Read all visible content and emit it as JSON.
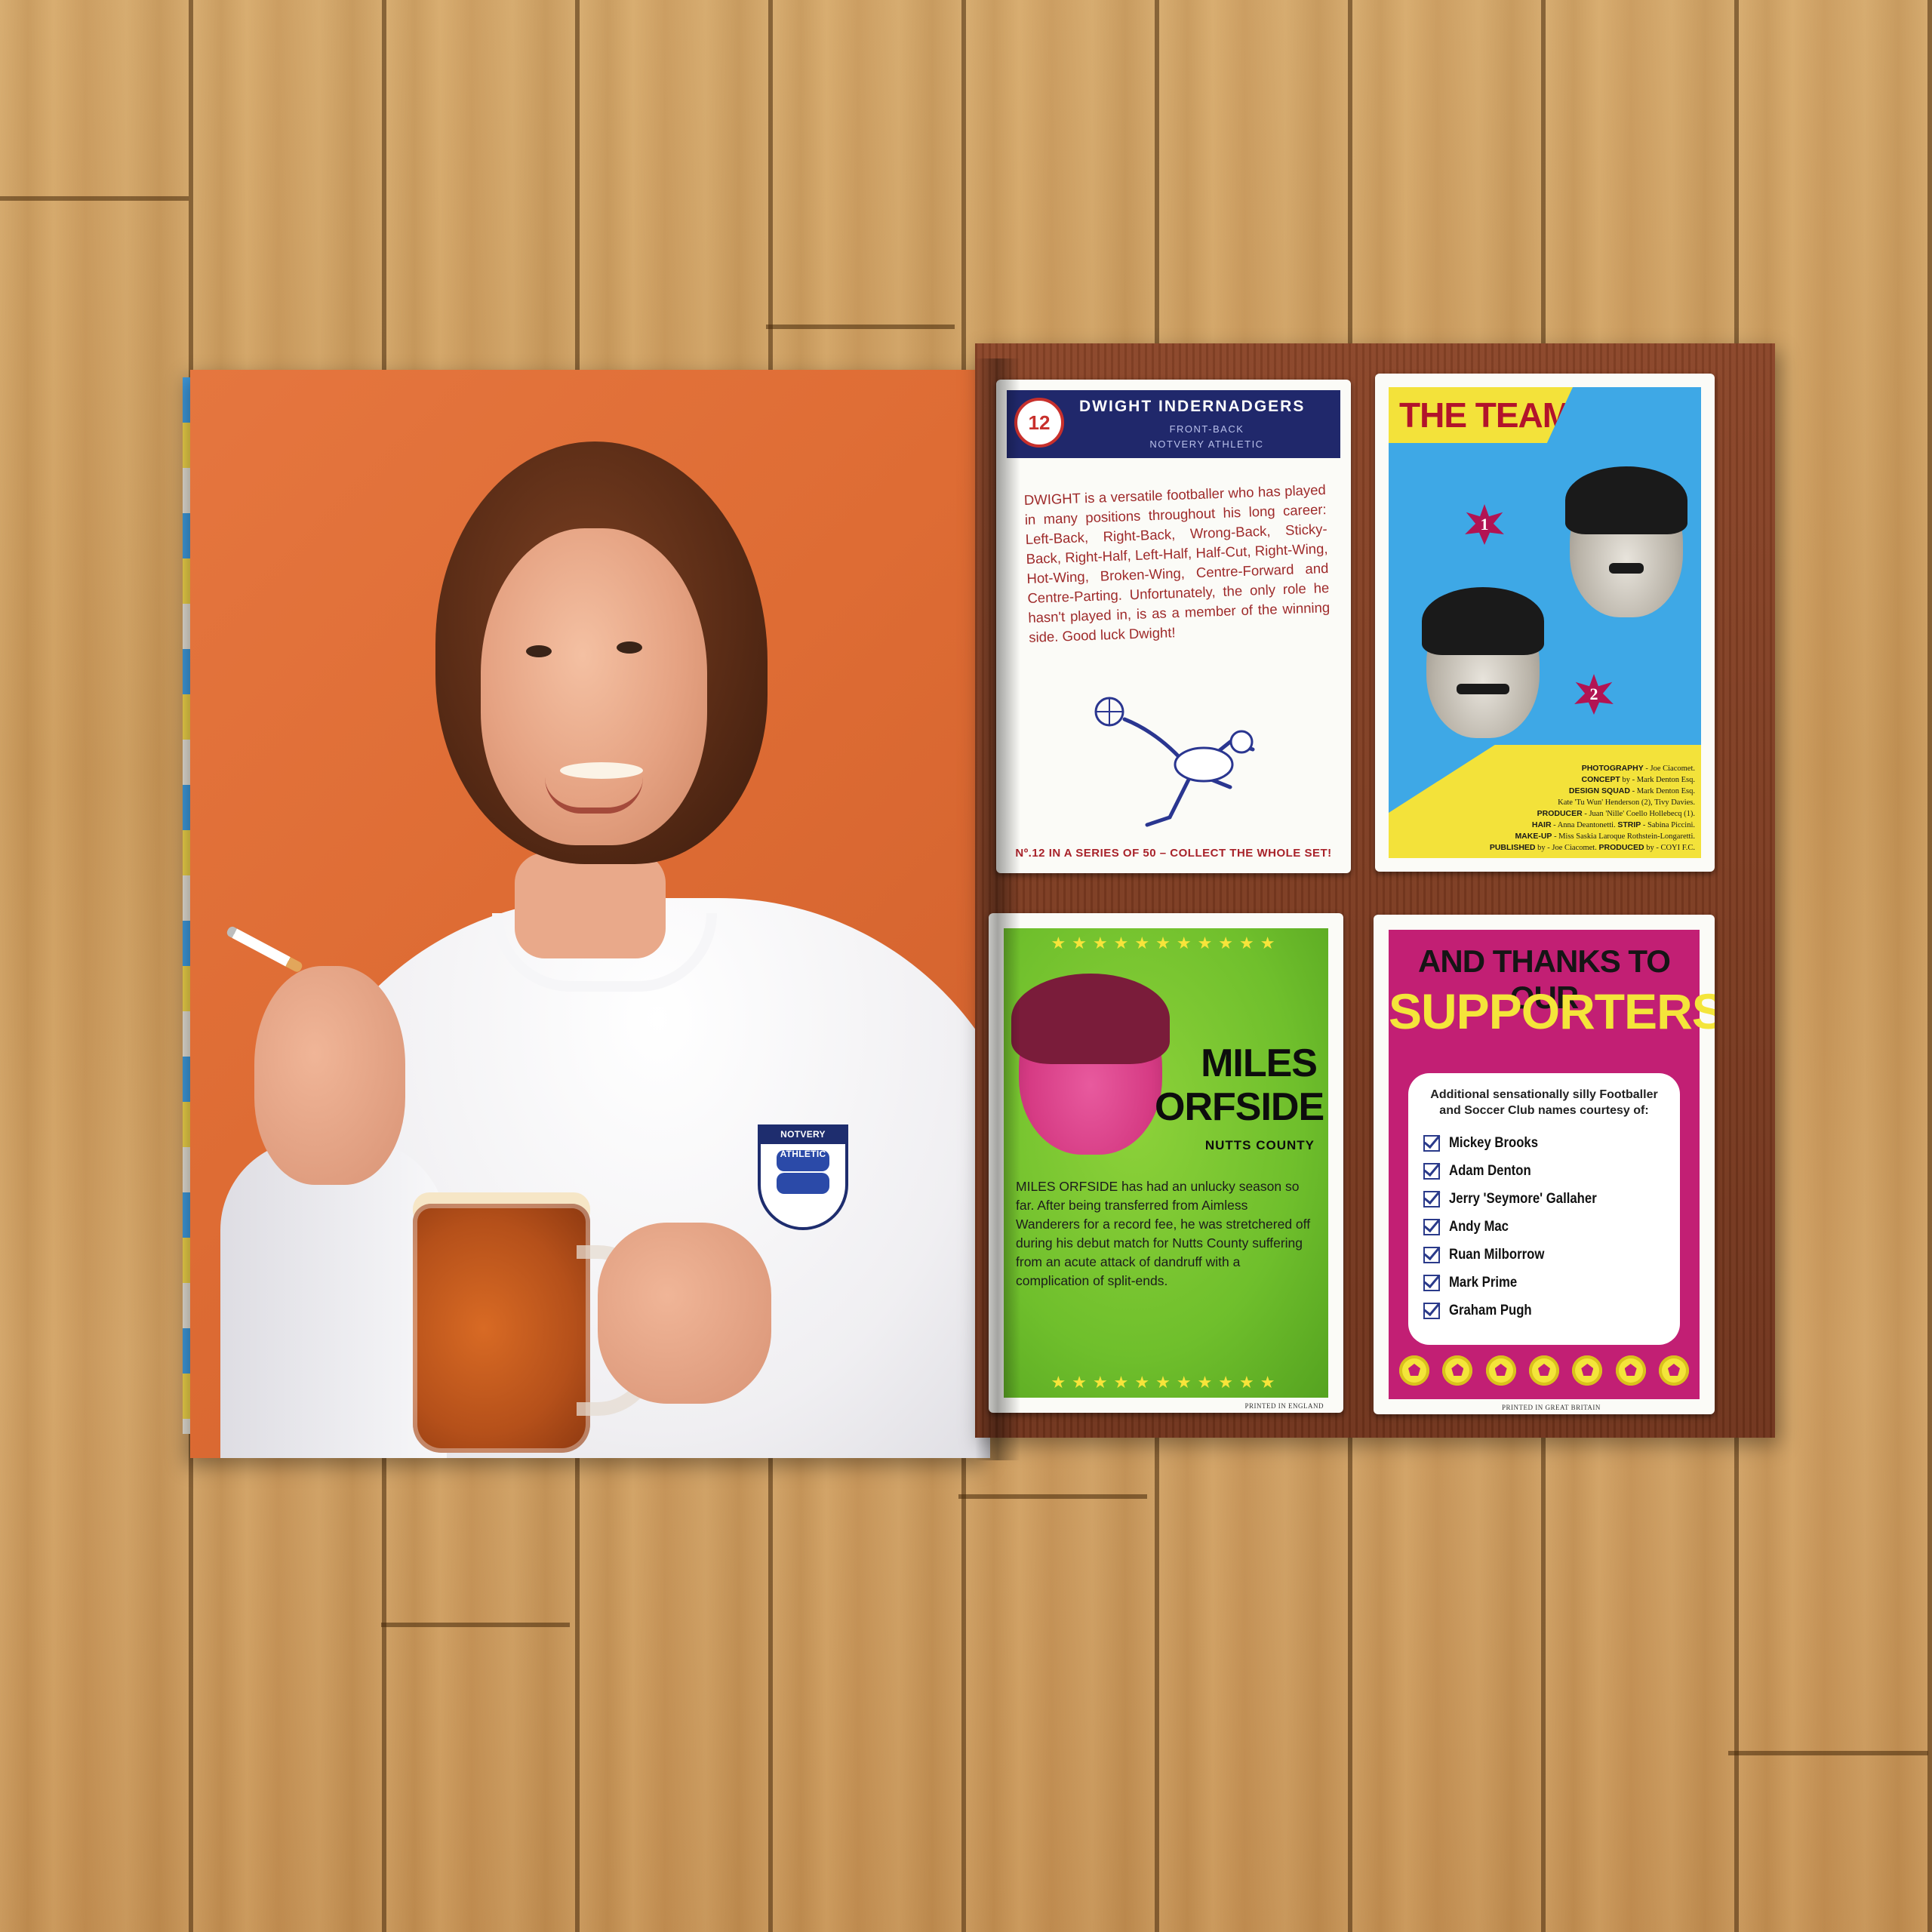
{
  "card_dwight": {
    "number": "12",
    "name": "DWIGHT INDERNADGERS",
    "position": "FRONT-BACK",
    "club": "NOTVERY ATHLETIC",
    "bio": "DWIGHT is a versatile footballer who has played in many positions throughout his long career: Left-Back, Right-Back, Wrong-Back, Sticky-Back, Right-Half, Left-Half, Half-Cut, Right-Wing, Hot-Wing, Broken-Wing, Centre-Forward and Centre-Parting. Unfortunately, the only role he hasn't played in, is as a member of the winning side. Good luck Dwight!",
    "footer": "Nº.12 IN A SERIES OF 50 – COLLECT THE WHOLE SET!"
  },
  "shirt_crest": {
    "label": "NOTVERY ATHLETIC"
  },
  "card_team": {
    "title": "THE TEAM",
    "marker_1": "1",
    "marker_2": "2",
    "credits": [
      {
        "role": "PHOTOGRAPHY",
        "text": " - Joe Ciacomet."
      },
      {
        "role": "CONCEPT",
        "text": " by - Mark Denton Esq."
      },
      {
        "role": "DESIGN SQUAD",
        "text": " - Mark Denton Esq."
      },
      {
        "role": "",
        "text": "Kate 'Tu Wun' Henderson (2), Tivy Davies."
      },
      {
        "role": "PRODUCER",
        "text": " - Juan 'Nille' Coello Hollebecq (1)."
      },
      {
        "role": "HAIR",
        "text": " - Anna Deantonetti. "
      },
      {
        "role": "STRIP",
        "text": " - Sabina Piccini."
      },
      {
        "role": "MAKE-UP",
        "text": " - Miss Saskia Laroque Rothstein-Longaretti."
      },
      {
        "role": "PUBLISHED",
        "text": " by - Joe Ciacomet. "
      },
      {
        "role": "PRODUCED",
        "text": " by - COYI F.C."
      }
    ]
  },
  "card_miles": {
    "name_line1": "MILES",
    "name_line2": "ORFSIDE",
    "club": "NUTTS COUNTY",
    "bio": "MILES ORFSIDE has had an unlucky season so far. After being transferred from Aimless Wanderers for a record fee, he was stretchered off during his debut match for Nutts County suffering from an acute attack of dandruff with a complication of split-ends.",
    "printed": "PRINTED IN ENGLAND"
  },
  "card_supporters": {
    "title_line1": "AND THANKS TO OUR",
    "title_line2": "SUPPORTERS",
    "intro": "Additional sensationally silly Footballer and Soccer Club names courtesy of:",
    "names": [
      "Mickey Brooks",
      "Adam Denton",
      "Jerry 'Seymore' Gallaher",
      "Andy Mac",
      "Ruan Milborrow",
      "Mark Prime",
      "Graham Pugh"
    ],
    "printed": "PRINTED IN GREAT BRITAIN"
  },
  "colors": {
    "photo_bg": "#de6c34",
    "navy": "#20286b",
    "team_blue": "#3ea8e6",
    "team_yellow": "#f3e23a",
    "miles_green": "#6fbf2c",
    "supporters_magenta": "#c21f74"
  }
}
